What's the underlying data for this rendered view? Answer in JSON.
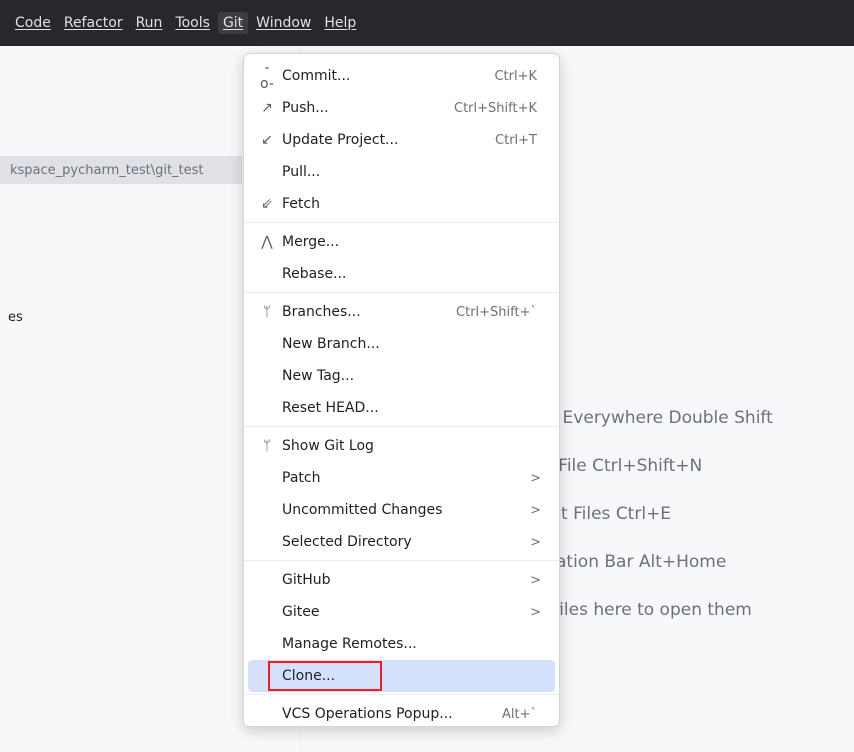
{
  "menubar": {
    "items": [
      "Code",
      "Refactor",
      "Run",
      "Tools",
      "Git",
      "Window",
      "Help"
    ],
    "active": "Git"
  },
  "left": {
    "path": "kspace_pycharm_test\\git_test",
    "partial_label": "es"
  },
  "hints": [
    "arch Everywhere Double Shift",
    "o to File Ctrl+Shift+N",
    "ecent Files Ctrl+E",
    "avigation Bar Alt+Home",
    "rop files here to open them"
  ],
  "git_menu": {
    "commit": {
      "label": "Commit...",
      "shortcut": "Ctrl+K",
      "icon": "commit-icon"
    },
    "push": {
      "label": "Push...",
      "shortcut": "Ctrl+Shift+K",
      "icon": "push-icon"
    },
    "update": {
      "label": "Update Project...",
      "shortcut": "Ctrl+T",
      "icon": "update-icon"
    },
    "pull": {
      "label": "Pull..."
    },
    "fetch": {
      "label": "Fetch",
      "icon": "fetch-icon"
    },
    "merge": {
      "label": "Merge...",
      "icon": "merge-icon"
    },
    "rebase": {
      "label": "Rebase..."
    },
    "branches": {
      "label": "Branches...",
      "shortcut": "Ctrl+Shift+`",
      "icon": "branch-icon"
    },
    "new_branch": {
      "label": "New Branch..."
    },
    "new_tag": {
      "label": "New Tag..."
    },
    "reset_head": {
      "label": "Reset HEAD..."
    },
    "show_log": {
      "label": "Show Git Log",
      "icon": "branch-icon"
    },
    "patch": {
      "label": "Patch"
    },
    "uncommitted": {
      "label": "Uncommitted Changes"
    },
    "selected_dir": {
      "label": "Selected Directory"
    },
    "github": {
      "label": "GitHub"
    },
    "gitee": {
      "label": "Gitee"
    },
    "manage_remotes": {
      "label": "Manage Remotes..."
    },
    "clone": {
      "label": "Clone..."
    },
    "vcs_popup": {
      "label": "VCS Operations Popup...",
      "shortcut": "Alt+`"
    }
  },
  "colors": {
    "menubar_bg": "#27282c",
    "highlight": "#d5e1fc",
    "annotation": "#ff1a1a"
  }
}
